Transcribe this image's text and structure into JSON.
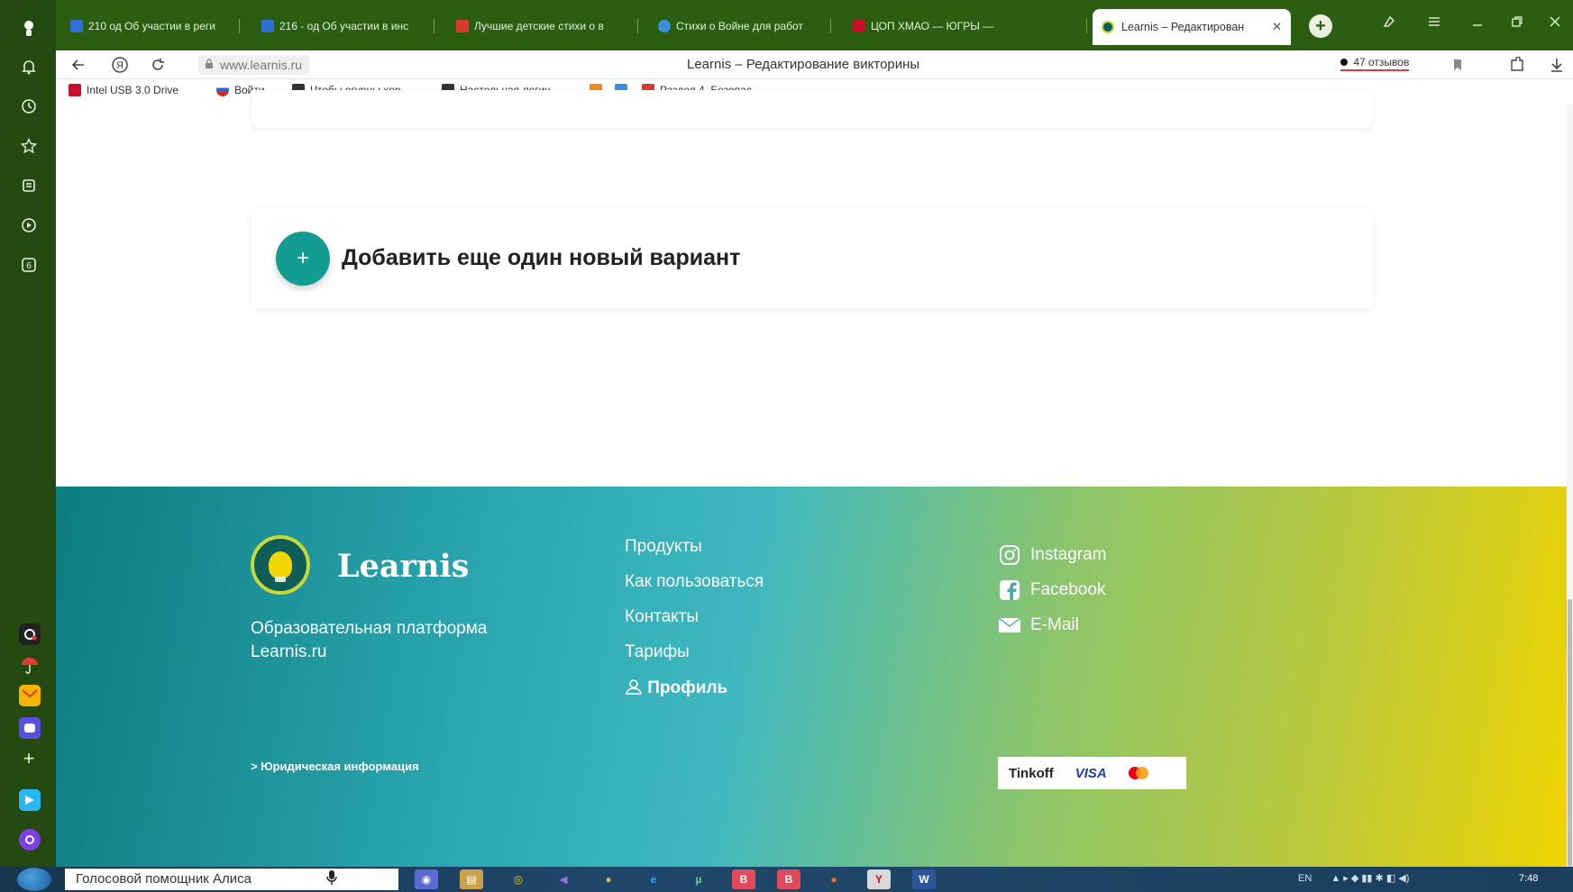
{
  "browser": {
    "tabs": [
      {
        "title": "210 од Об участии в реги",
        "favicon_color": "#2f6fd6"
      },
      {
        "title": "216 - од Об участии в инс",
        "favicon_color": "#2f6fd6"
      },
      {
        "title": "Лучшие детские стихи о в",
        "favicon_color": "#d93a2b"
      },
      {
        "title": "Стихи о Войне для работ",
        "favicon_color": "#3a8fd9"
      },
      {
        "title": "ЦОП ХМАО — ЮГРЫ —",
        "favicon_color": "#c8102e"
      }
    ],
    "active_tab": {
      "title": "Learnis – Редактирован",
      "close": "✕"
    },
    "new_tab": "+",
    "url_domain": "www.learnis.ru",
    "page_title": "Learnis – Редактирование викторины",
    "reviews_label": "47 отзывов",
    "bookmarks": [
      {
        "label": "Intel USB 3.0 Drive",
        "color": "#c8102e"
      },
      {
        "label": "Войти",
        "color": "#2d63c8"
      },
      {
        "label": "Чтобы огурцы хор",
        "color": "#333333"
      },
      {
        "label": "Настольная логич",
        "color": "#333333"
      },
      {
        "label": "",
        "color": "#f08a1c"
      },
      {
        "label": "",
        "color": "#3a8fd9"
      },
      {
        "label": "Раздел 4. Безопас",
        "color": "#d93a2b"
      }
    ]
  },
  "content": {
    "add_variant_label": "Добавить еще один новый вариант",
    "add_icon": "+"
  },
  "footer": {
    "brand": "Learnis",
    "tagline": "Образовательная платформа Learnis.ru",
    "links": [
      "Продукты",
      "Как пользоваться",
      "Контакты",
      "Тарифы"
    ],
    "profile_label": "Профиль",
    "social": [
      {
        "label": "Instagram",
        "icon": "instagram-icon"
      },
      {
        "label": "Facebook",
        "icon": "facebook-icon"
      },
      {
        "label": "E-Mail",
        "icon": "mail-icon"
      }
    ],
    "legal_label": "> Юридическая информация",
    "payments": {
      "tinkoff": "Tinkoff",
      "visa": "VISA"
    }
  },
  "taskbar": {
    "assistant_label": "Голосовой помощник Алиса",
    "lang": "EN",
    "time": "7:48"
  },
  "colors": {
    "browser_green": "#2c5e12",
    "side_panel": "#244a11",
    "accent_teal": "#139c91"
  }
}
